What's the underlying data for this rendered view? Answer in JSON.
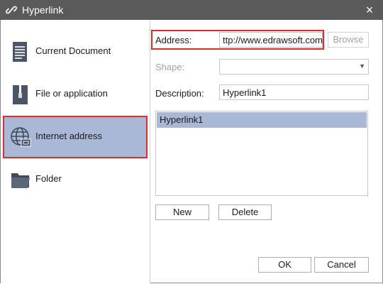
{
  "window": {
    "title": "Hyperlink",
    "close_glyph": "×"
  },
  "sidebar": {
    "items": [
      {
        "label": "Current Document",
        "icon": "document-icon"
      },
      {
        "label": "File or application",
        "icon": "file-application-icon"
      },
      {
        "label": "Internet address",
        "icon": "globe-icon",
        "selected": true
      },
      {
        "label": "Folder",
        "icon": "folder-icon"
      }
    ]
  },
  "form": {
    "address_label": "Address:",
    "address_value": "ttp://www.edrawsoft.com",
    "browse_label": "Browse",
    "shape_label": "Shape:",
    "shape_value": "",
    "description_label": "Description:",
    "description_value": "Hyperlink1"
  },
  "links": {
    "items": [
      "Hyperlink1"
    ]
  },
  "buttons": {
    "new_label": "New",
    "delete_label": "Delete",
    "ok_label": "OK",
    "cancel_label": "Cancel"
  },
  "colors": {
    "titlebar": "#5a5a5a",
    "selection": "#aab8d7",
    "highlight_border": "#e12a2a"
  }
}
